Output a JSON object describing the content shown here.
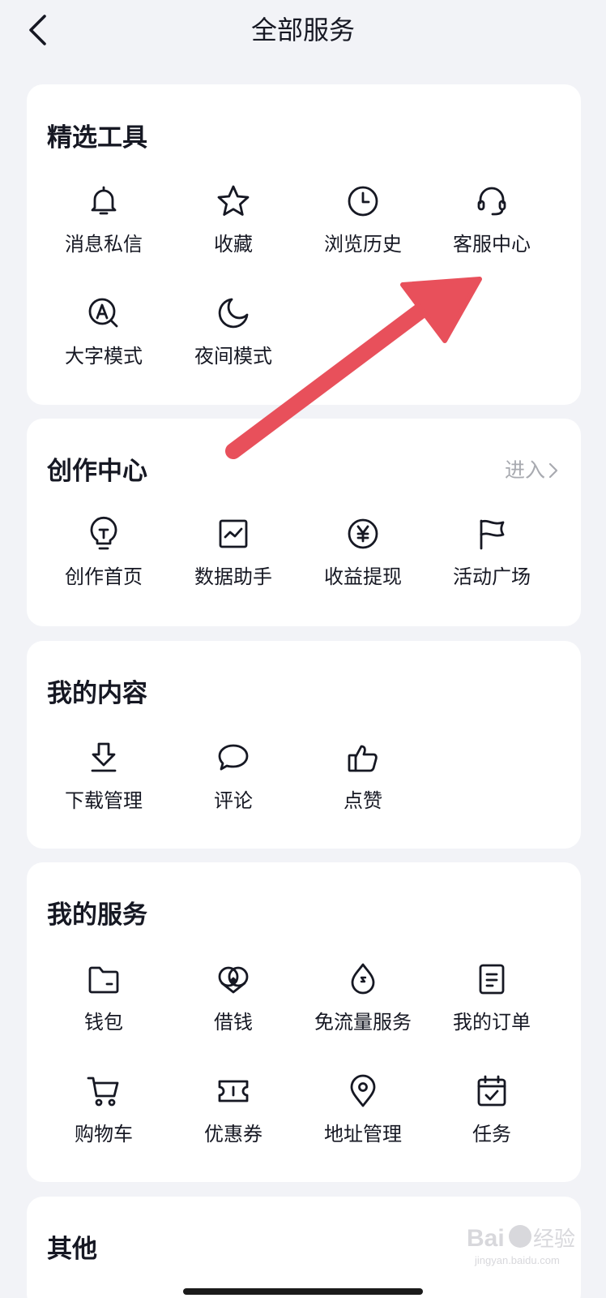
{
  "header": {
    "title": "全部服务",
    "back_icon": "chevron-left-icon"
  },
  "sections": {
    "featured": {
      "title": "精选工具",
      "items": [
        {
          "label": "消息私信",
          "icon": "bell-icon"
        },
        {
          "label": "收藏",
          "icon": "star-icon"
        },
        {
          "label": "浏览历史",
          "icon": "clock-icon"
        },
        {
          "label": "客服中心",
          "icon": "headset-icon"
        },
        {
          "label": "大字模式",
          "icon": "zoom-a-icon"
        },
        {
          "label": "夜间模式",
          "icon": "moon-icon"
        }
      ]
    },
    "creator": {
      "title": "创作中心",
      "link_label": "进入",
      "items": [
        {
          "label": "创作首页",
          "icon": "lightbulb-icon"
        },
        {
          "label": "数据助手",
          "icon": "chart-icon"
        },
        {
          "label": "收益提现",
          "icon": "yen-icon"
        },
        {
          "label": "活动广场",
          "icon": "flag-icon"
        }
      ]
    },
    "content": {
      "title": "我的内容",
      "items": [
        {
          "label": "下载管理",
          "icon": "download-icon"
        },
        {
          "label": "评论",
          "icon": "comment-icon"
        },
        {
          "label": "点赞",
          "icon": "thumbs-up-icon"
        }
      ]
    },
    "services": {
      "title": "我的服务",
      "items": [
        {
          "label": "钱包",
          "icon": "wallet-icon"
        },
        {
          "label": "借钱",
          "icon": "loan-icon"
        },
        {
          "label": "免流量服务",
          "icon": "data-drop-icon"
        },
        {
          "label": "我的订单",
          "icon": "order-icon"
        },
        {
          "label": "购物车",
          "icon": "cart-icon"
        },
        {
          "label": "优惠券",
          "icon": "coupon-icon"
        },
        {
          "label": "地址管理",
          "icon": "location-pin-icon"
        },
        {
          "label": "任务",
          "icon": "calendar-check-icon"
        }
      ]
    },
    "other": {
      "title": "其他"
    }
  },
  "watermark": "Baidu 经验 jingyan.baidu.com",
  "colors": {
    "background": "#f2f3f7",
    "card": "#ffffff",
    "text": "#161823",
    "muted": "#a8aab0",
    "annotation_arrow": "#e8505b"
  }
}
